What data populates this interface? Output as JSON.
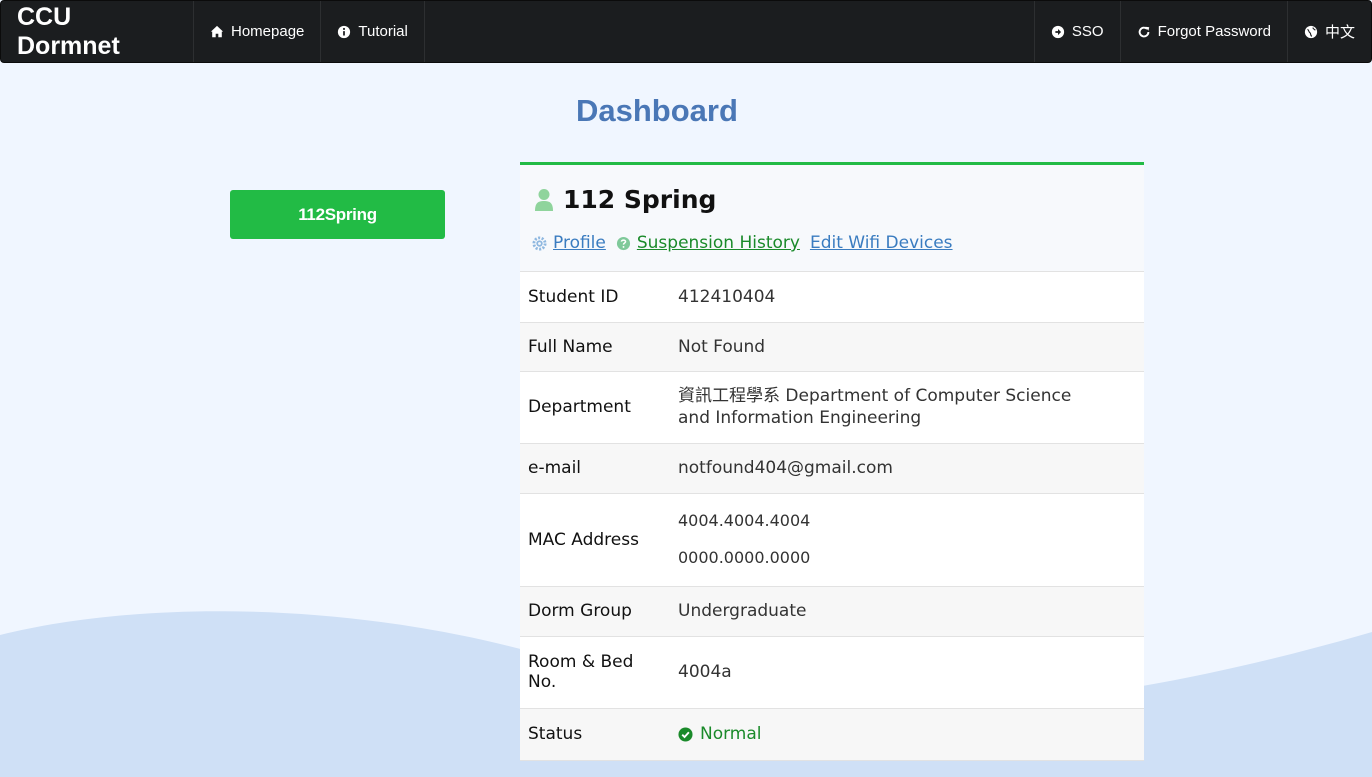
{
  "navbar": {
    "brand": "CCU Dormnet",
    "left_items": [
      {
        "label": "Homepage",
        "icon": "home-icon"
      },
      {
        "label": "Tutorial",
        "icon": "info-icon"
      }
    ],
    "right_items": [
      {
        "label": "SSO",
        "icon": "arrow-circle-right-icon"
      },
      {
        "label": "Forgot Password",
        "icon": "refresh-icon"
      },
      {
        "label": "中文",
        "icon": "globe-icon"
      }
    ]
  },
  "page_title": "Dashboard",
  "term_button": "112Spring",
  "card": {
    "title": "112 Spring",
    "links": {
      "profile": "Profile",
      "suspension": "Suspension History",
      "wifi": "Edit Wifi Devices"
    },
    "rows": {
      "student_id": {
        "key": "Student ID",
        "value": "412410404"
      },
      "full_name": {
        "key": "Full Name",
        "value": "Not Found"
      },
      "department": {
        "key": "Department",
        "value": "資訊工程學系 Department of Computer Science and Information Engineering"
      },
      "email": {
        "key": "e-mail",
        "value": "notfound404@gmail.com"
      },
      "mac": {
        "key": "MAC Address",
        "values": [
          "4004.4004.4004",
          "0000.0000.0000"
        ]
      },
      "dorm_group": {
        "key": "Dorm Group",
        "value": "Undergraduate"
      },
      "room": {
        "key": "Room & Bed No.",
        "value": "4004a"
      },
      "status": {
        "key": "Status",
        "value": "Normal"
      }
    }
  },
  "colors": {
    "navbar_bg": "#1b1d1f",
    "accent_green": "#22bb45",
    "title_blue": "#4a77b6",
    "link_blue": "#3a7cc0",
    "status_green": "#1a8a2a",
    "page_bg": "#f0f6ff",
    "wave": "#cfe0f6"
  }
}
